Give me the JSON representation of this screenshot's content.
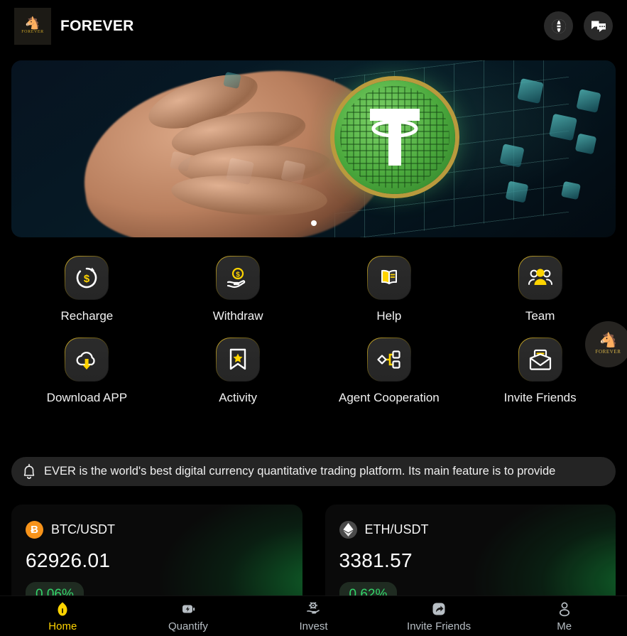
{
  "header": {
    "brand_name": "FOREVER",
    "logo_wordmark": "FOREVER",
    "globe_icon": "globe-icon",
    "chat_icon": "chat-icon"
  },
  "banner": {
    "alt": "hand holding tether usdt coin with holographic grid",
    "slide_count": 1,
    "active_slide": 1
  },
  "shortcuts": [
    {
      "label": "Recharge",
      "icon": "recharge-icon"
    },
    {
      "label": "Withdraw",
      "icon": "withdraw-icon"
    },
    {
      "label": "Help",
      "icon": "help-book-icon"
    },
    {
      "label": "Team",
      "icon": "team-icon"
    },
    {
      "label": "Download APP",
      "icon": "cloud-download-icon"
    },
    {
      "label": "Activity",
      "icon": "bookmark-star-icon"
    },
    {
      "label": "Agent Cooperation",
      "icon": "network-nodes-icon"
    },
    {
      "label": "Invite Friends",
      "icon": "envelope-icon"
    }
  ],
  "notice": {
    "icon": "bell-icon",
    "text": "EVER is the world's best digital currency quantitative trading platform. Its main feature is to provide"
  },
  "markets": [
    {
      "pair": "BTC/USDT",
      "symbol": "Ƀ",
      "icon": "bitcoin-icon",
      "price": "62926.01",
      "change": "0.06%",
      "change_color": "#33d46a"
    },
    {
      "pair": "ETH/USDT",
      "symbol": "◆",
      "icon": "ethereum-icon",
      "price": "3381.57",
      "change": "0.62%",
      "change_color": "#33d46a"
    }
  ],
  "floating_button": {
    "name": "forever-float-button",
    "wordmark": "FOREVER"
  },
  "bottom_nav": [
    {
      "label": "Home",
      "icon": "home-icon",
      "active": true
    },
    {
      "label": "Quantify",
      "icon": "quantify-bolt-icon",
      "active": false
    },
    {
      "label": "Invest",
      "icon": "invest-hand-icon",
      "active": false
    },
    {
      "label": "Invite Friends",
      "icon": "share-arrow-icon",
      "active": false
    },
    {
      "label": "Me",
      "icon": "person-icon",
      "active": false
    }
  ],
  "colors": {
    "accent": "#ffd400",
    "gold": "#d8b52e",
    "positive": "#33d46a",
    "background": "#000000",
    "tile": "#2b2b2b"
  }
}
